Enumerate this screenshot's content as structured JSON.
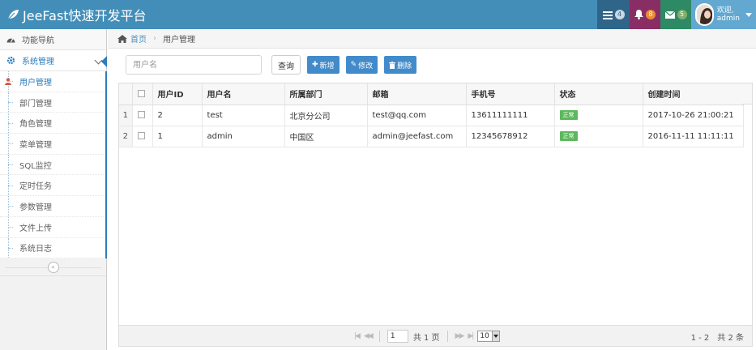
{
  "app": {
    "title": "JeeFast快速开发平台"
  },
  "navbar": {
    "tasks_badge": "4",
    "notifications_badge": "8",
    "messages_badge": "5",
    "welcome": "欢迎,",
    "username": "admin"
  },
  "sidebar": {
    "nav_label": "功能导航",
    "system_label": "系统管理",
    "items": [
      {
        "label": "用户管理"
      },
      {
        "label": "部门管理"
      },
      {
        "label": "角色管理"
      },
      {
        "label": "菜单管理"
      },
      {
        "label": "SQL监控"
      },
      {
        "label": "定时任务"
      },
      {
        "label": "参数管理"
      },
      {
        "label": "文件上传"
      },
      {
        "label": "系统日志"
      }
    ],
    "collapse_glyph": "«"
  },
  "breadcrumb": {
    "home": "首页",
    "sep": "›",
    "current": "用户管理"
  },
  "toolbar": {
    "search_placeholder": "用户名",
    "query": "查询",
    "add": "新增",
    "edit": "修改",
    "delete": "删除"
  },
  "table": {
    "headers": [
      "用户ID",
      "用户名",
      "所属部门",
      "邮箱",
      "手机号",
      "状态",
      "创建时间"
    ],
    "rows": [
      {
        "rn": "1",
        "id": "2",
        "username": "test",
        "dept": "北京分公司",
        "email": "test@qq.com",
        "mobile": "13611111111",
        "status": "正常",
        "created": "2017-10-26 21:00:21"
      },
      {
        "rn": "2",
        "id": "1",
        "username": "admin",
        "dept": "中国区",
        "email": "admin@jeefast.com",
        "mobile": "12345678912",
        "status": "正常",
        "created": "2016-11-11 11:11:11"
      }
    ]
  },
  "pager": {
    "page": "1",
    "total_pages": "共 1 页",
    "page_size": "10",
    "info": "1 - 2　共 2 条"
  },
  "colors": {
    "navbar": "#438eb9",
    "tasks": "#2e6589",
    "notifications": "#892e65",
    "messages": "#2e8965",
    "user": "#62a8d1",
    "primary_button": "#428bca",
    "status_ok": "#5cb85c"
  }
}
